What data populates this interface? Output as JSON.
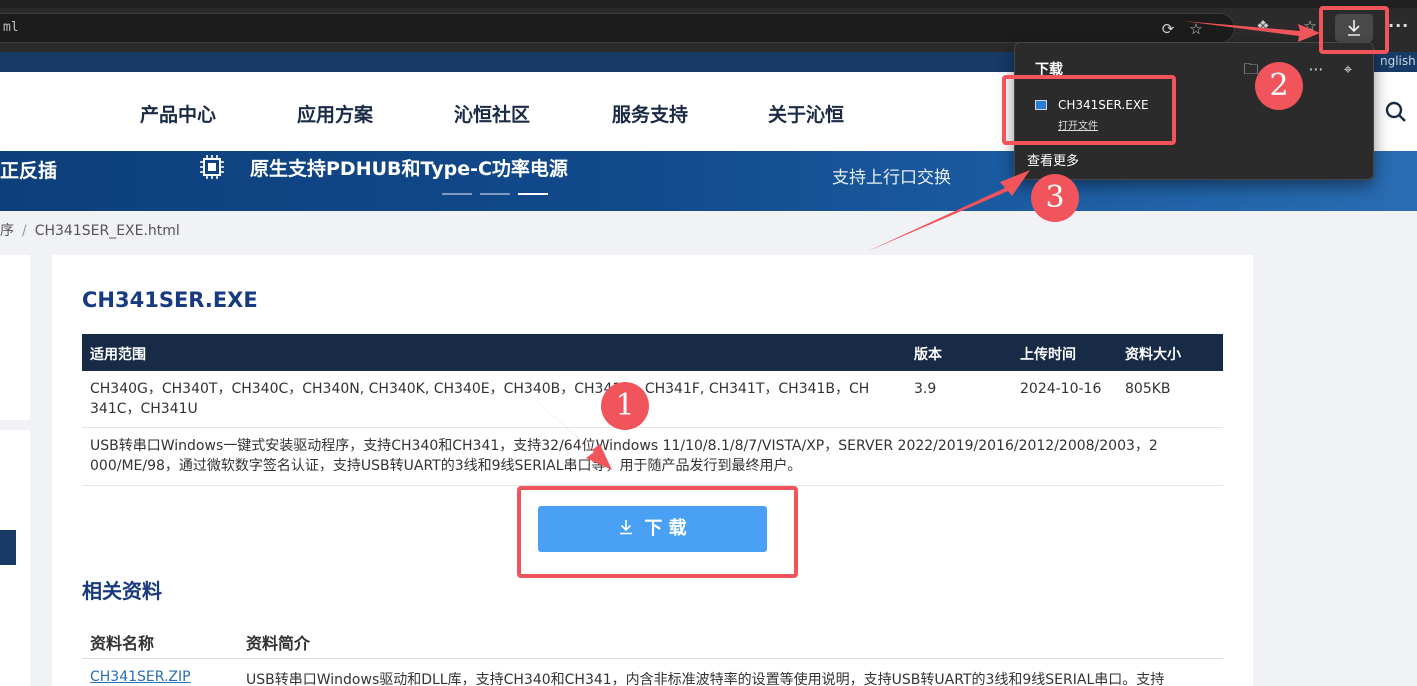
{
  "browser": {
    "address_text": "ml",
    "more_label": "···"
  },
  "site": {
    "lang": "nglish",
    "nav": [
      "产品中心",
      "应用方案",
      "沁恒社区",
      "服务支持",
      "关于沁恒"
    ]
  },
  "banner": {
    "left_text": "正反插",
    "main_text": "原生支持PDHUB和Type-C功率电源",
    "right_text": "支持上行口交换"
  },
  "breadcrumb": {
    "prev": "序",
    "current": "CH341SER_EXE.html"
  },
  "product": {
    "title": "CH341SER.EXE",
    "headers": {
      "scope": "适用范围",
      "version": "版本",
      "upload_time": "上传时间",
      "size": "资料大小"
    },
    "scope_line1": "CH340G，CH340T，CH340C，CH340N, CH340K, CH340E，CH340B，CH341A，CH341F, CH341T，CH341B，CH",
    "scope_line2": "341C，CH341U",
    "version": "3.9",
    "upload_time": "2024-10-16",
    "size": "805KB",
    "desc_line1": "USB转串口Windows一键式安装驱动程序，支持CH340和CH341，支持32/64位Windows 11/10/8.1/8/7/VISTA/XP，SERVER 2022/2019/2016/2012/2008/2003，2",
    "desc_line2": "000/ME/98，通过微软数字签名认证，支持USB转UART的3线和9线SERIAL串口等，用于随产品发行到最终用户。",
    "download_label": "下 载"
  },
  "related": {
    "title": "相关资料",
    "col_name": "资料名称",
    "col_desc": "资料简介",
    "rows": [
      {
        "name": "CH341SER.ZIP",
        "desc": "USB转串口Windows驱动和DLL库，支持CH340和CH341，内含非标准波特率的设置等使用说明，支持USB转UART的3线和9线SERIAL串口。支持"
      }
    ]
  },
  "flyout": {
    "title": "下载",
    "file_name": "CH341SER.EXE",
    "open_file": "打开文件",
    "see_more": "查看更多"
  },
  "annotations": {
    "badges": [
      "1",
      "2",
      "3"
    ],
    "color": "#f2545b"
  }
}
